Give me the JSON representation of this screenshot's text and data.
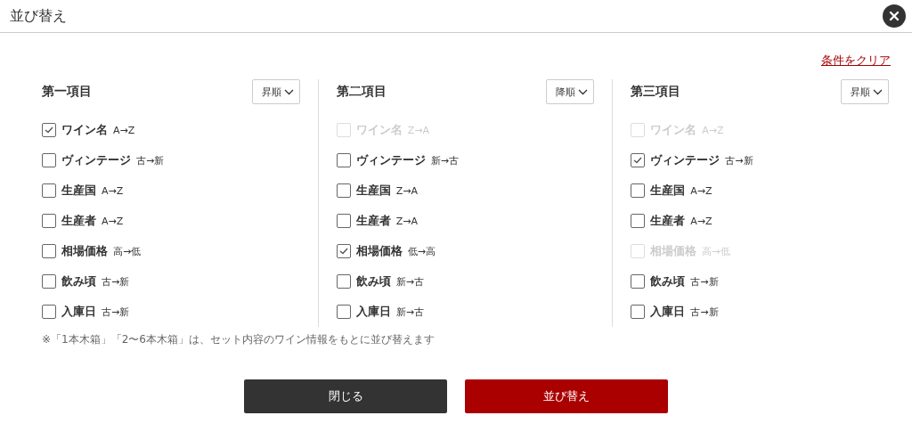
{
  "dialog": {
    "title": "並び替え"
  },
  "clear_link": "条件をクリア",
  "columns": [
    {
      "title": "第一項目",
      "order": "昇順",
      "items": [
        {
          "name": "ワイン名",
          "direction": "A→Z",
          "checked": true,
          "disabled": false
        },
        {
          "name": "ヴィンテージ",
          "direction": "古→新",
          "checked": false,
          "disabled": false
        },
        {
          "name": "生産国",
          "direction": "A→Z",
          "checked": false,
          "disabled": false
        },
        {
          "name": "生産者",
          "direction": "A→Z",
          "checked": false,
          "disabled": false
        },
        {
          "name": "相場価格",
          "direction": "高→低",
          "checked": false,
          "disabled": false
        },
        {
          "name": "飲み頃",
          "direction": "古→新",
          "checked": false,
          "disabled": false
        },
        {
          "name": "入庫日",
          "direction": "古→新",
          "checked": false,
          "disabled": false
        }
      ]
    },
    {
      "title": "第二項目",
      "order": "降順",
      "items": [
        {
          "name": "ワイン名",
          "direction": "Z→A",
          "checked": false,
          "disabled": true
        },
        {
          "name": "ヴィンテージ",
          "direction": "新→古",
          "checked": false,
          "disabled": false
        },
        {
          "name": "生産国",
          "direction": "Z→A",
          "checked": false,
          "disabled": false
        },
        {
          "name": "生産者",
          "direction": "Z→A",
          "checked": false,
          "disabled": false
        },
        {
          "name": "相場価格",
          "direction": "低→高",
          "checked": true,
          "disabled": false
        },
        {
          "name": "飲み頃",
          "direction": "新→古",
          "checked": false,
          "disabled": false
        },
        {
          "name": "入庫日",
          "direction": "新→古",
          "checked": false,
          "disabled": false
        }
      ]
    },
    {
      "title": "第三項目",
      "order": "昇順",
      "items": [
        {
          "name": "ワイン名",
          "direction": "A→Z",
          "checked": false,
          "disabled": true
        },
        {
          "name": "ヴィンテージ",
          "direction": "古→新",
          "checked": true,
          "disabled": false
        },
        {
          "name": "生産国",
          "direction": "A→Z",
          "checked": false,
          "disabled": false
        },
        {
          "name": "生産者",
          "direction": "A→Z",
          "checked": false,
          "disabled": false
        },
        {
          "name": "相場価格",
          "direction": "高→低",
          "checked": false,
          "disabled": true
        },
        {
          "name": "飲み頃",
          "direction": "古→新",
          "checked": false,
          "disabled": false
        },
        {
          "name": "入庫日",
          "direction": "古→新",
          "checked": false,
          "disabled": false
        }
      ]
    }
  ],
  "note": "※「1本木箱」「2〜6本木箱」は、セット内容のワイン情報をもとに並び替えます",
  "buttons": [
    {
      "kind": "secondary",
      "label": "閉じる"
    },
    {
      "kind": "primary",
      "label": "並び替え"
    }
  ]
}
